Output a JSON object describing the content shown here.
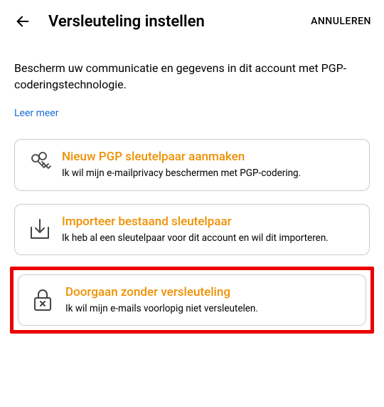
{
  "header": {
    "title": "Versleuteling instellen",
    "cancel": "ANNULEREN"
  },
  "intro": "Bescherm uw communicatie en gegevens in dit account met PGP-coderingstechnologie.",
  "learn_more": "Leer meer",
  "options": [
    {
      "title": "Nieuw PGP sleutelpaar aanmaken",
      "desc": "Ik wil mijn e-mailprivacy beschermen met PGP-codering."
    },
    {
      "title": "Importeer bestaand sleutelpaar",
      "desc": "Ik heb al een sleutelpaar voor dit account en wil dit importeren."
    },
    {
      "title": "Doorgaan zonder versleuteling",
      "desc": "Ik wil mijn e-mails voorlopig niet versleutelen."
    }
  ]
}
